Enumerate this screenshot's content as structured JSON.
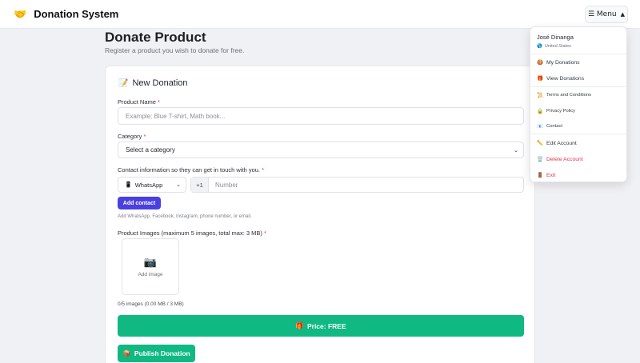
{
  "navbar": {
    "brand_icon": "🤝",
    "brand_name": "Donation System",
    "menu_label": "☰ Menu",
    "menu_caret": "▲"
  },
  "page": {
    "title": "Donate Product",
    "subtitle": "Register a product you wish to donate for free."
  },
  "form": {
    "card_title_icon": "📝",
    "card_title": "New Donation",
    "product_name": {
      "label": "Product Name",
      "required": "*",
      "placeholder": "Example: Blue T-shirt, Math book..."
    },
    "category": {
      "label": "Category",
      "required": "*",
      "selected": "Select a category"
    },
    "contact": {
      "label": "Contact information so they can get in touch with you.",
      "required": "*",
      "type_icon": "📱",
      "type_selected": "WhatsApp",
      "prefix": "+1",
      "number_placeholder": "Number",
      "add_button": "Add contact",
      "hint": "Add WhatsApp, Facebook, Instagram, phone number, or email."
    },
    "images": {
      "label": "Product Images (maximum 5 images, total max: 3 MB)",
      "required": "*",
      "add_icon": "📷",
      "add_label": "Add image",
      "count_text": "0/5 images (0.00 MB / 3 MB)"
    },
    "price": {
      "icon": "🎁",
      "label": "Price: FREE"
    },
    "publish": {
      "icon": "📦",
      "label": "Publish Donation"
    }
  },
  "dropdown": {
    "user_name": "José Dinanga",
    "user_country_icon": "🌎",
    "user_country": "United States",
    "items": [
      {
        "icon": "🍪",
        "label": "My Donations"
      },
      {
        "icon": "🎁",
        "label": "View Donations"
      },
      {
        "icon": "📜",
        "label": "Terms and Conditions"
      },
      {
        "icon": "🔒",
        "label": "Privacy Policy"
      },
      {
        "icon": "📧",
        "label": "Contact"
      },
      {
        "icon": "✏️",
        "label": "Edit Account"
      },
      {
        "icon": "🗑️",
        "label": "Delete Account"
      },
      {
        "icon": "🚪",
        "label": "Exit"
      }
    ]
  },
  "colors": {
    "primary": "#4a3fe0",
    "success": "#10b981",
    "danger": "#dc3545"
  }
}
